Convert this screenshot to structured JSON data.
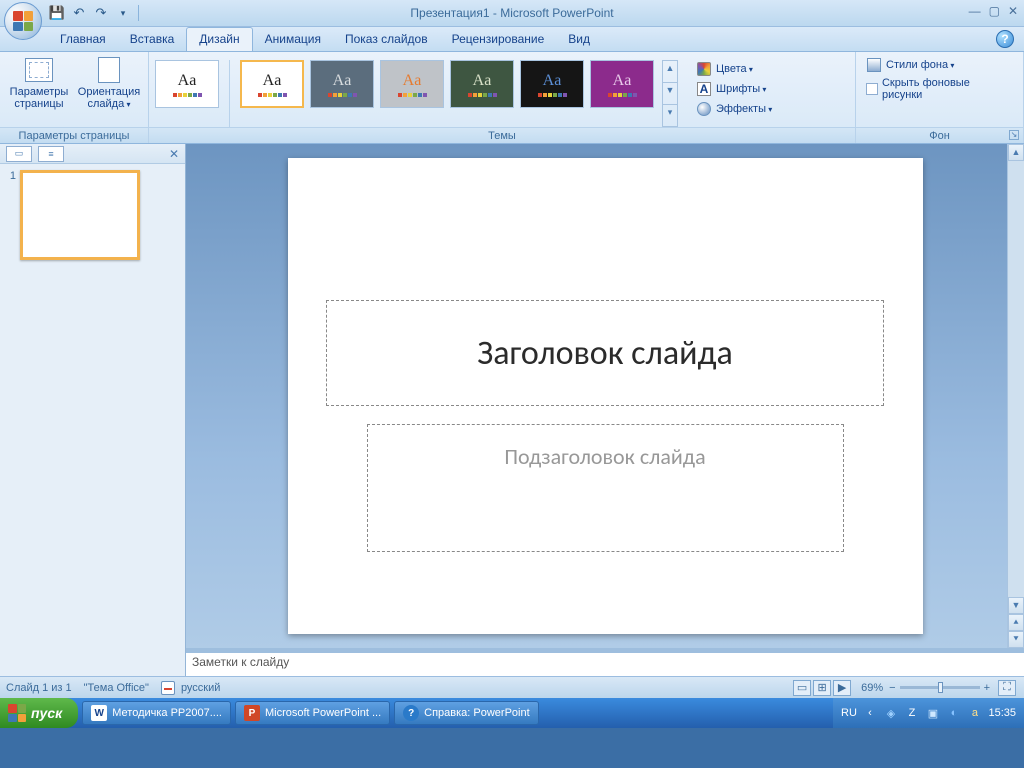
{
  "title": "Презентация1 - Microsoft PowerPoint",
  "tabs": [
    "Главная",
    "Вставка",
    "Дизайн",
    "Анимация",
    "Показ слайдов",
    "Рецензирование",
    "Вид"
  ],
  "activeTabIndex": 2,
  "ribbon": {
    "page_setup": {
      "label": "Параметры страницы",
      "page_params": "Параметры\nстраницы",
      "orientation": "Ориентация\nслайда"
    },
    "themes": {
      "label": "Темы",
      "colors": "Цвета",
      "fonts": "Шрифты",
      "effects": "Эффекты"
    },
    "background": {
      "label": "Фон",
      "styles": "Стили фона",
      "hide": "Скрыть фоновые рисунки"
    }
  },
  "slide": {
    "number": "1",
    "title_placeholder": "Заголовок слайда",
    "subtitle_placeholder": "Подзаголовок слайда"
  },
  "notes_placeholder": "Заметки к слайду",
  "statusbar": {
    "slide_count": "Слайд 1 из 1",
    "theme": "\"Тема Office\"",
    "language": "русский",
    "zoom": "69%"
  },
  "taskbar": {
    "start": "пуск",
    "items": [
      "Методичка PP2007....",
      "Microsoft PowerPoint ...",
      "Справка: PowerPoint"
    ],
    "lang": "RU",
    "clock": "15:35"
  },
  "theme_tiles": [
    {
      "bg": "#ffffff",
      "fg": "#222222"
    },
    {
      "bg": "#ffffff",
      "fg": "#222222"
    },
    {
      "bg": "#5b6d7d",
      "fg": "#d8dcdf"
    },
    {
      "bg": "#bfc3c8",
      "fg": "#e57a2f"
    },
    {
      "bg": "#3e5641",
      "fg": "#d7e0c7"
    },
    {
      "bg": "#151515",
      "fg": "#5c8fd6"
    },
    {
      "bg": "#8c2b8c",
      "fg": "#e9c9ea"
    }
  ],
  "dot_colors": [
    "#d9452f",
    "#f2a03a",
    "#e8d23a",
    "#7ba848",
    "#3e78b3",
    "#7f55b0"
  ]
}
